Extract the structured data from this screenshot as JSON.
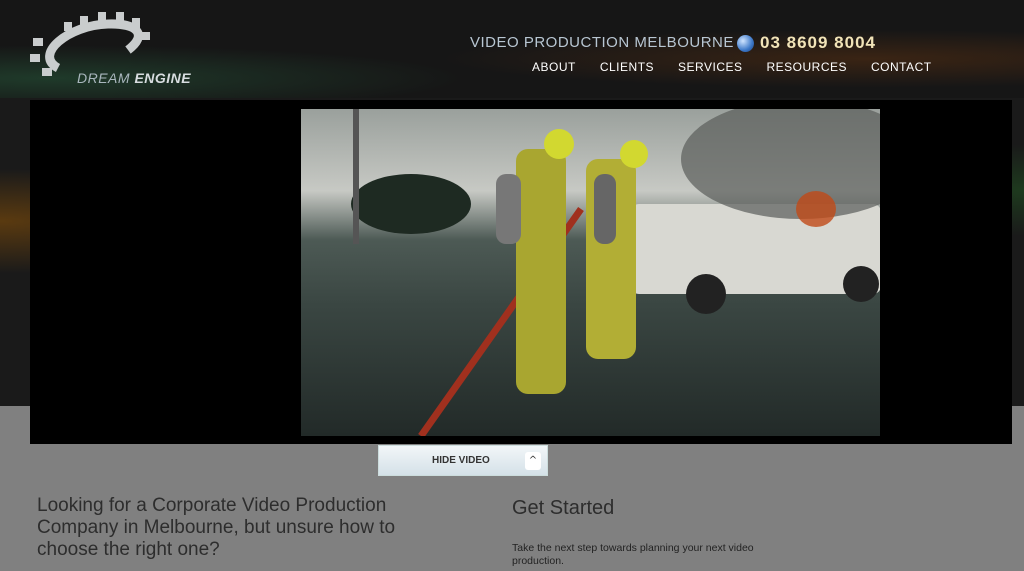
{
  "header": {
    "logo_text_a": "DREAM",
    "logo_text_b": " ENGINE",
    "tagline": "VIDEO PRODUCTION MELBOURNE",
    "phone": "03 8609 8004",
    "nav": [
      "ABOUT",
      "CLIENTS",
      "SERVICES",
      "RESOURCES",
      "CONTACT"
    ]
  },
  "video": {
    "hide_label": "HIDE VIDEO",
    "toggle_icon": "chevron-up-icon"
  },
  "content": {
    "lead": "Looking for a Corporate Video Production Company in Melbourne, but unsure how to choose the right one?",
    "get_started_title": "Get Started",
    "get_started_text": "Take the next step towards planning your next video production."
  }
}
